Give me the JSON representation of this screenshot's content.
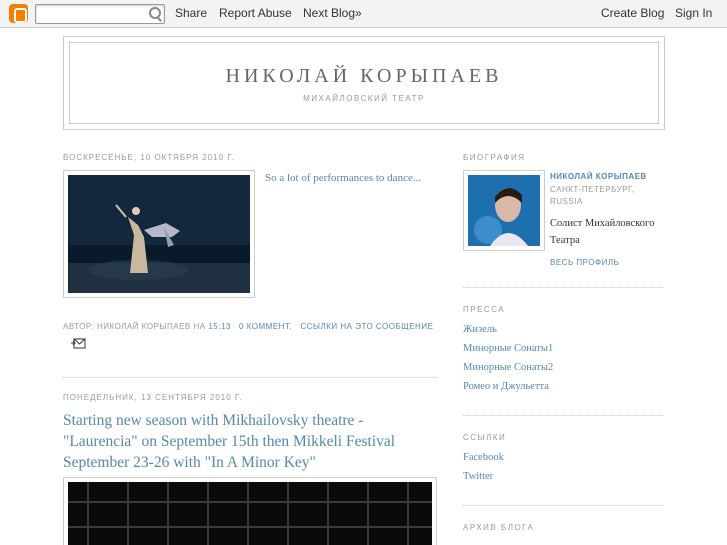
{
  "navbar": {
    "share": "Share",
    "report_abuse": "Report Abuse",
    "next_blog": "Next Blog»",
    "create_blog": "Create Blog",
    "sign_in": "Sign In",
    "search_value": ""
  },
  "header": {
    "title": "НИКОЛАЙ КОРЫПАЕВ",
    "description": "МИХАЙЛОВСКИЙ ТЕАТР"
  },
  "posts": [
    {
      "date": "ВОСКРЕСЕНЬЕ, 10 ОКТЯБРЯ 2010 Г.",
      "body": "So a lot of performances to dance...",
      "footer": {
        "author_prefix": "АВТОР: НИКОЛАЙ КОРЫПАЕВ НА",
        "time": "15:13",
        "comments": "0 КОММЕНТ.",
        "links": "ССЫЛКИ НА ЭТО СООБЩЕНИЕ"
      }
    },
    {
      "date": "ПОНЕДЕЛЬНИК, 13 СЕНТЯБРЯ 2010 Г.",
      "title": "Starting new season with Mikhailovsky theatre - \"Laurencia\" on September 15th then Mikkeli Festival September 23-26 with \"In A Minor Key\""
    }
  ],
  "sidebar": {
    "bio_heading": "БИОГРАФИЯ",
    "profile": {
      "name": "НИКОЛАЙ КОРЫПАЕВ",
      "location": "САНКТ-ПЕТЕРБУРГ, RUSSIA",
      "about": "Солист Михайловского Театра",
      "full_profile": "ВЕСЬ ПРОФИЛЬ"
    },
    "press_heading": "ПРЕССА",
    "press_links": [
      "Жизель",
      "Минорные Сонаты1",
      "Минорные Сонаты2",
      "Ромео и Джульетта"
    ],
    "links_heading": "ССЫЛКИ",
    "links": [
      "Facebook",
      "Twitter"
    ],
    "archive_heading": "АРХИВ БЛОГА"
  },
  "colors": {
    "link": "#5588aa",
    "muted": "#999999",
    "border": "#cccccc",
    "blogger_orange": "#f57d00"
  }
}
